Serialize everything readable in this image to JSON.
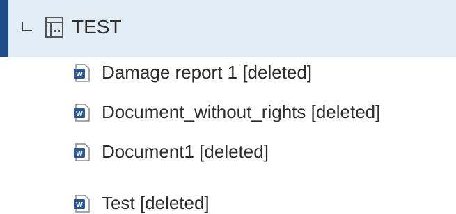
{
  "tree": {
    "folder": {
      "label": "TEST",
      "icon": "building-folder-icon",
      "expanded": true,
      "selected": true
    },
    "items": [
      {
        "label": "Damage report 1 [deleted]",
        "icon": "word-document-icon"
      },
      {
        "label": "Document_without_rights [deleted]",
        "icon": "word-document-icon"
      },
      {
        "label": "Document1 [deleted]",
        "icon": "word-document-icon"
      },
      {
        "label": "Test [deleted]",
        "icon": "word-document-icon"
      }
    ]
  },
  "colors": {
    "selected_row_bg": "#e2ecf4",
    "selection_bar": "#1f4f86",
    "word_icon": "#2b5797",
    "text": "#2d2d2d"
  }
}
